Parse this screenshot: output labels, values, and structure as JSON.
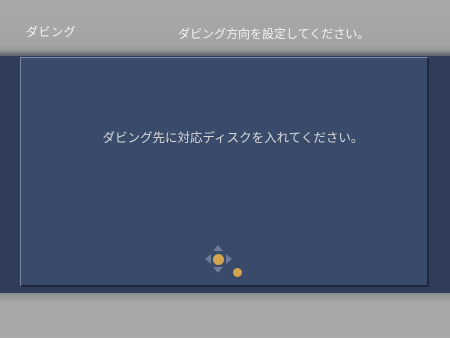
{
  "header": {
    "mode_title": "ダビング",
    "instruction": "ダビング方向を設定してください。"
  },
  "dialog": {
    "message": "ダビング先に対応ディスクを入れてください。"
  },
  "icons": {
    "navigation": "dpad-icon",
    "confirm": "enter-icon",
    "back": "return-icon"
  },
  "colors": {
    "background": "#2f3d5a",
    "panel": "#3a4a6b",
    "bar": "#a9a9a9",
    "accent": "#d5a44e"
  }
}
